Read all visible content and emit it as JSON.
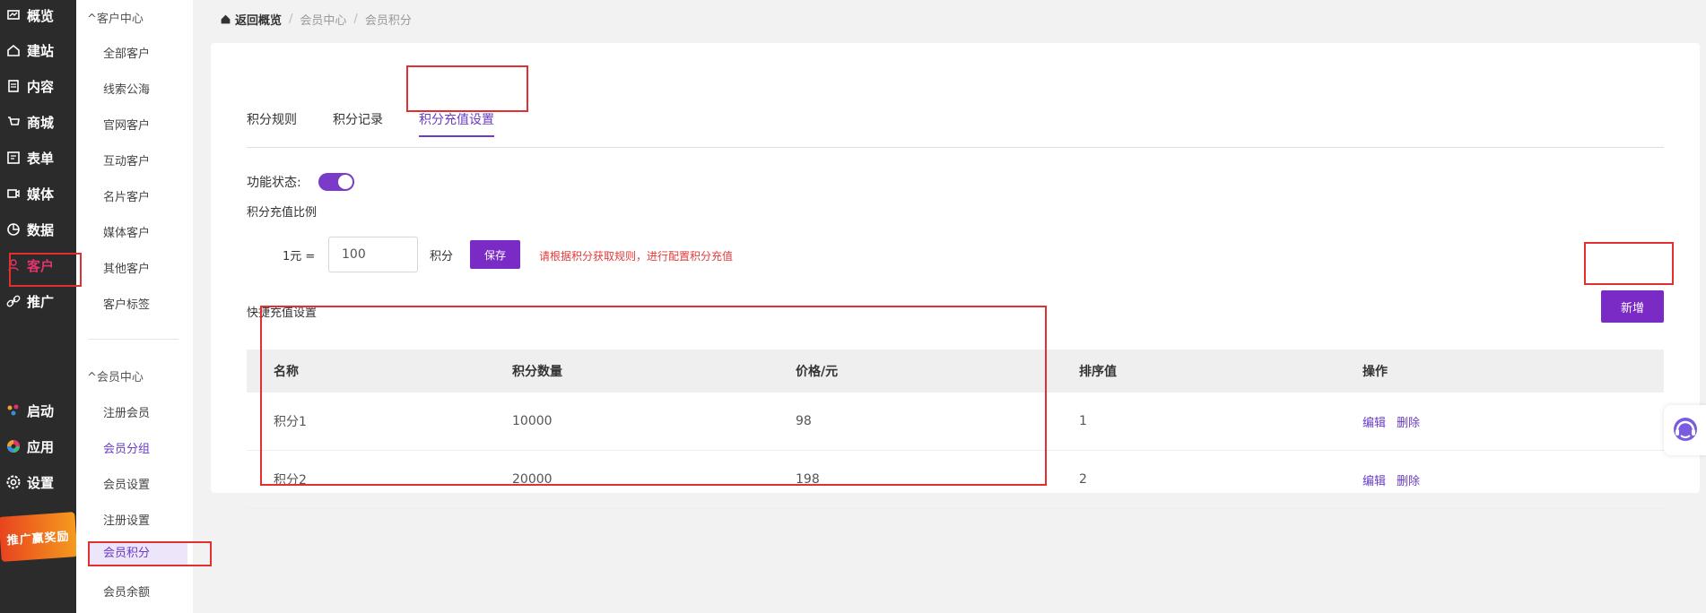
{
  "nav": {
    "items": [
      {
        "label": "概览",
        "icon": "overview-icon"
      },
      {
        "label": "建站",
        "icon": "home-icon"
      },
      {
        "label": "内容",
        "icon": "document-icon"
      },
      {
        "label": "商城",
        "icon": "cart-icon"
      },
      {
        "label": "表单",
        "icon": "form-icon"
      },
      {
        "label": "媒体",
        "icon": "video-icon"
      },
      {
        "label": "数据",
        "icon": "chart-icon"
      },
      {
        "label": "客户",
        "icon": "user-icon"
      },
      {
        "label": "推广",
        "icon": "link-icon"
      },
      {
        "label": "启动",
        "icon": "launch-icon"
      },
      {
        "label": "应用",
        "icon": "apps-icon"
      },
      {
        "label": "设置",
        "icon": "gear-icon"
      }
    ],
    "promo_label": "推广赢奖励",
    "active_color": "#e0356e"
  },
  "subnav": {
    "group1": "客户中心",
    "group1_items": [
      "全部客户",
      "线索公海",
      "官网客户",
      "互动客户",
      "名片客户",
      "媒体客户",
      "其他客户",
      "客户标签"
    ],
    "group2": "会员中心",
    "group2_items": [
      "注册会员",
      "会员分组",
      "会员设置",
      "注册设置",
      "会员积分",
      "会员余额"
    ]
  },
  "breadcrumb": {
    "home": "返回概览",
    "level1": "会员中心",
    "level2": "会员积分",
    "sep": "/"
  },
  "tabs": [
    "积分规则",
    "积分记录",
    "积分充值设置"
  ],
  "active_tab": "积分充值设置",
  "settings": {
    "feature_status_label": "功能状态:",
    "feature_enabled": true,
    "ratio_label": "积分充值比例",
    "yuan_label": "1元 =",
    "ratio_value": "100",
    "points_unit": "积分",
    "save_label": "保存",
    "hint": "请根据积分获取规则，进行配置积分充值"
  },
  "quick": {
    "title": "快捷充值设置",
    "add_label": "新增"
  },
  "table": {
    "headers": [
      "名称",
      "积分数量",
      "价格/元",
      "排序值",
      "操作"
    ],
    "rows": [
      {
        "name": "积分1",
        "points": "10000",
        "price": "98",
        "sort": "1"
      },
      {
        "name": "积分2",
        "points": "20000",
        "price": "198",
        "sort": "2"
      }
    ],
    "edit_label": "编辑",
    "delete_label": "删除"
  },
  "colors": {
    "accent": "#7a2bc6",
    "highlight": "#e23030",
    "hint": "#e23b3b"
  }
}
